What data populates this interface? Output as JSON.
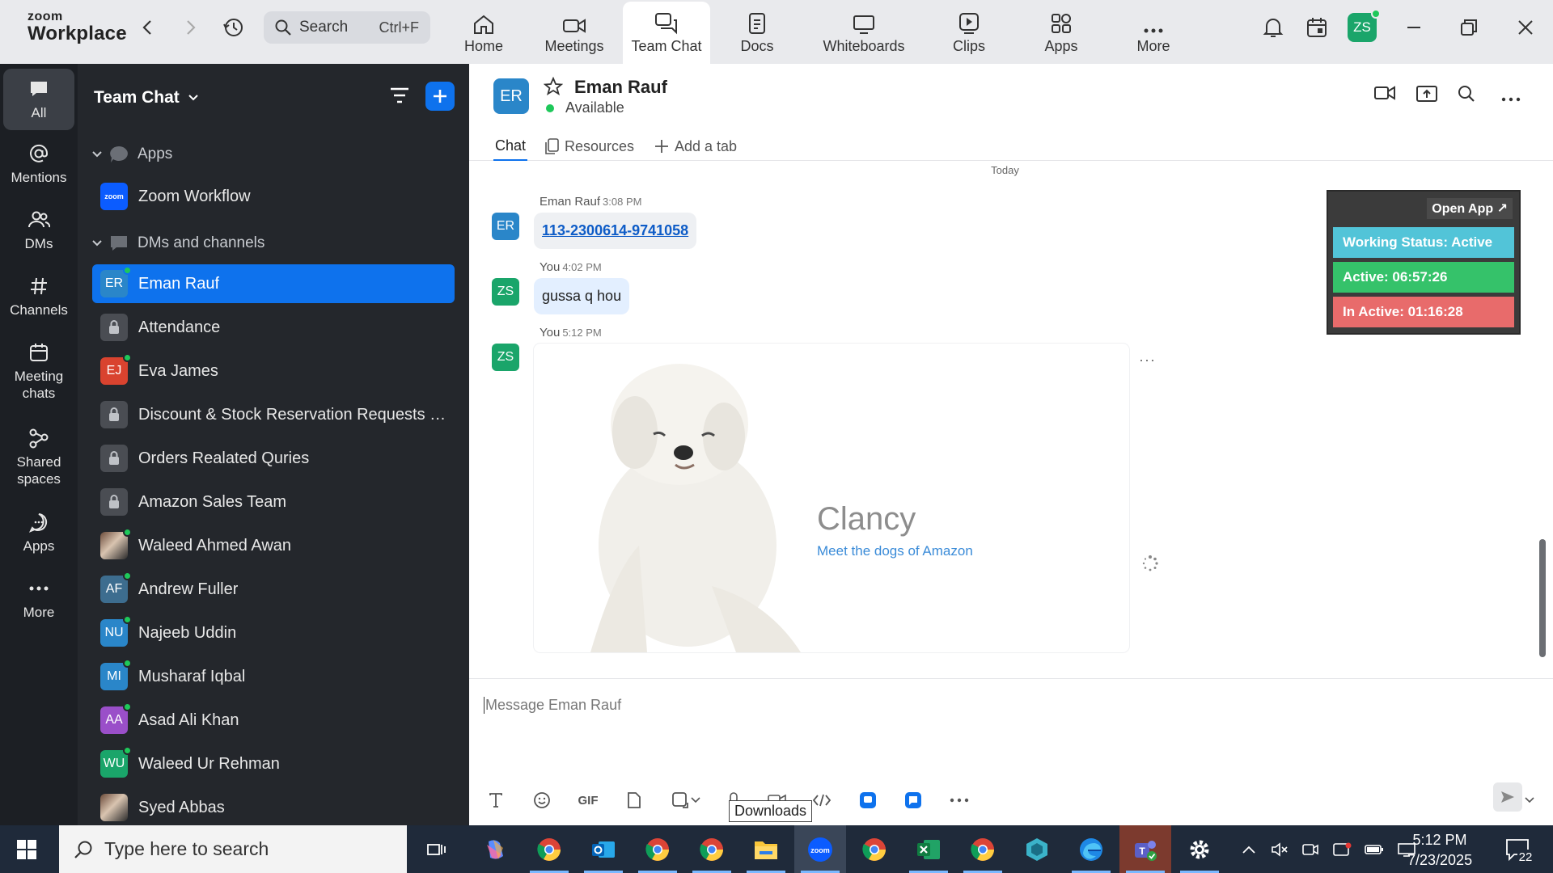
{
  "app": {
    "logo_line1": "zoom",
    "logo_line2": "Workplace"
  },
  "search": {
    "label": "Search",
    "shortcut": "Ctrl+F"
  },
  "top_tabs": [
    {
      "label": "Home",
      "icon": "home-icon"
    },
    {
      "label": "Meetings",
      "icon": "video-camera-icon"
    },
    {
      "label": "Team Chat",
      "icon": "chat-bubbles-icon",
      "active": true
    },
    {
      "label": "Docs",
      "icon": "document-icon"
    },
    {
      "label": "Whiteboards",
      "icon": "whiteboard-icon"
    },
    {
      "label": "Clips",
      "icon": "clips-icon"
    },
    {
      "label": "Apps",
      "icon": "apps-icon"
    },
    {
      "label": "More",
      "icon": "more-dots-icon"
    }
  ],
  "user": {
    "initials": "ZS"
  },
  "rail": [
    {
      "label": "All",
      "icon": "chat-icon",
      "active": true
    },
    {
      "label": "Mentions",
      "icon": "at-icon"
    },
    {
      "label": "DMs",
      "icon": "people-icon"
    },
    {
      "label": "Channels",
      "icon": "hash-icon"
    },
    {
      "label": "Meeting chats",
      "icon": "calendar-icon"
    },
    {
      "label": "Shared spaces",
      "icon": "shared-spaces-icon"
    },
    {
      "label": "Apps",
      "icon": "apps-chat-icon"
    },
    {
      "label": "More",
      "icon": "more-dots-icon"
    }
  ],
  "list": {
    "title": "Team Chat",
    "sections": {
      "apps": "Apps",
      "dms": "DMs and channels"
    },
    "app_item": {
      "name": "Zoom Workflow",
      "badge": "zoom"
    },
    "items": [
      {
        "name": "Eman Rauf",
        "initials": "ER",
        "color": "#2a86c9",
        "online": true,
        "active": true
      },
      {
        "name": "Attendance",
        "lock": true
      },
      {
        "name": "Eva James",
        "initials": "EJ",
        "color": "#d9432f",
        "online": true
      },
      {
        "name": "Discount & Stock Reservation Requests O...",
        "lock": true
      },
      {
        "name": "Orders Realated Quries",
        "lock": true
      },
      {
        "name": "Amazon Sales Team",
        "lock": true
      },
      {
        "name": "Waleed Ahmed Awan",
        "photo": true,
        "online": true
      },
      {
        "name": "Andrew Fuller",
        "initials": "AF",
        "color": "#3d6d8f",
        "online": true
      },
      {
        "name": "Najeeb Uddin",
        "initials": "NU",
        "color": "#2a86c9",
        "online": true
      },
      {
        "name": "Musharaf Iqbal",
        "initials": "MI",
        "color": "#2a86c9",
        "online": true
      },
      {
        "name": "Asad Ali Khan",
        "initials": "AA",
        "color": "#9a4fc9",
        "online": true
      },
      {
        "name": "Waleed Ur Rehman",
        "initials": "WU",
        "color": "#1aa56a",
        "online": true
      },
      {
        "name": "Syed Abbas",
        "photo": true
      }
    ]
  },
  "chat": {
    "name": "Eman Rauf",
    "initials": "ER",
    "status": "Available",
    "tabs": {
      "chat": "Chat",
      "resources": "Resources",
      "add": "Add a tab"
    },
    "day_divider": "Today",
    "messages": [
      {
        "sender": "Eman Rauf",
        "time": "3:08 PM",
        "initials": "ER",
        "text": "113-2300614-9741058"
      },
      {
        "sender": "You",
        "time": "4:02 PM",
        "initials": "ZS",
        "text": "gussa q hou"
      },
      {
        "sender": "You",
        "time": "5:12 PM",
        "initials": "ZS",
        "image_title": "Clancy",
        "image_subtitle": "Meet the dogs of Amazon"
      }
    ],
    "status_panel": {
      "open_app": "Open App ↗",
      "working": "Working Status: Active",
      "active": "Active: 06:57:26",
      "inactive": "In Active: 01:16:28"
    },
    "composer": {
      "placeholder": "Message Eman Rauf",
      "gif": "GIF",
      "tooltip": "Downloads"
    }
  },
  "taskbar": {
    "search_placeholder": "Type here to search",
    "time": "5:12 PM",
    "date": "7/23/2025",
    "notifications": "22"
  },
  "colors": {
    "accent": "#0e72ed",
    "online": "#1ec85a",
    "status_active_bg": "#52c4d8",
    "status_time_bg": "#35c26a",
    "status_inactive_bg": "#e86b6b"
  }
}
